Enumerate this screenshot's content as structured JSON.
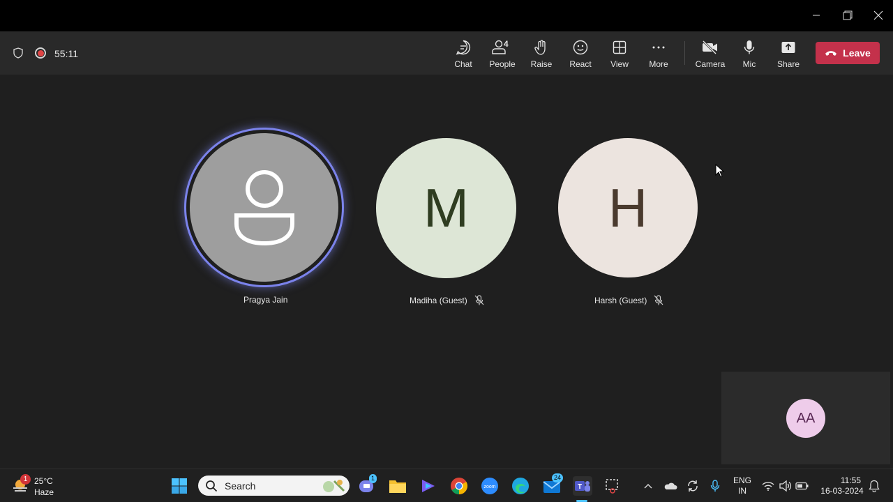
{
  "meeting": {
    "timer": "55:11",
    "toolbar": {
      "chat": "Chat",
      "people": "People",
      "people_count": "4",
      "raise": "Raise",
      "react": "React",
      "view": "View",
      "more": "More",
      "camera": "Camera",
      "mic": "Mic",
      "share": "Share",
      "leave": "Leave"
    },
    "participants": [
      {
        "name": "Pragya Jain",
        "initial": "",
        "avatar_color": "#9e9e9e",
        "speaking": true,
        "muted": false
      },
      {
        "name": "Madiha (Guest)",
        "initial": "M",
        "avatar_color": "#dde6d6",
        "text_color": "#2f3d21",
        "muted": true
      },
      {
        "name": "Harsh (Guest)",
        "initial": "H",
        "avatar_color": "#ece4df",
        "text_color": "#4a3a2e",
        "muted": true
      }
    ],
    "self_view": {
      "initials": "AA"
    }
  },
  "taskbar": {
    "weather": {
      "temp": "25°C",
      "condition": "Haze",
      "badge": "1"
    },
    "search_placeholder": "Search",
    "chat_badge": "1",
    "mail_badge": "24",
    "language": {
      "line1": "ENG",
      "line2": "IN"
    },
    "clock": {
      "time": "11:55",
      "date": "16-03-2024"
    }
  },
  "colors": {
    "accent": "#7b83eb",
    "leave": "#c4314b",
    "taskbar_accent": "#4cc2ff"
  }
}
